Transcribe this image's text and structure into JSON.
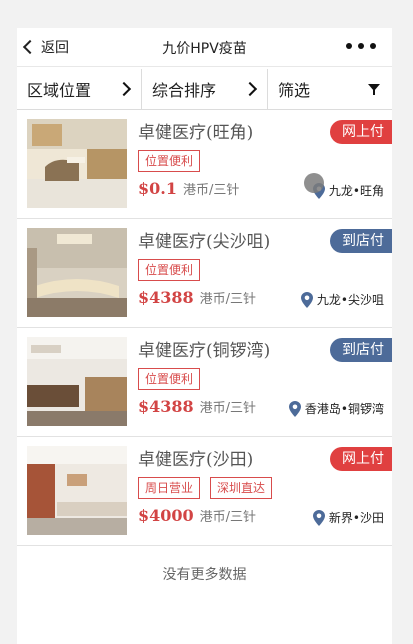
{
  "nav": {
    "back_label": "返回",
    "title": "九价HPV疫苗"
  },
  "filters": [
    {
      "label": "区域位置",
      "icon": "chevron-right-icon"
    },
    {
      "label": "综合排序",
      "icon": "chevron-right-icon"
    },
    {
      "label": "筛选",
      "icon": "filter-icon"
    }
  ],
  "clinics": [
    {
      "name": "卓健医疗(旺角)",
      "payment": "网上付",
      "payment_color": "#e04040",
      "tags": [
        "位置便利"
      ],
      "price": "$0.1",
      "unit": "港币/三针",
      "location": "九龙•旺角"
    },
    {
      "name": "卓健医疗(尖沙咀)",
      "payment": "到店付",
      "payment_color": "#4d6b99",
      "tags": [
        "位置便利"
      ],
      "price": "$4388",
      "unit": "港币/三针",
      "location": "九龙•尖沙咀"
    },
    {
      "name": "卓健医疗(铜锣湾)",
      "payment": "到店付",
      "payment_color": "#4d6b99",
      "tags": [
        "位置便利"
      ],
      "price": "$4388",
      "unit": "港币/三针",
      "location": "香港岛•铜锣湾"
    },
    {
      "name": "卓健医疗(沙田)",
      "payment": "网上付",
      "payment_color": "#e04040",
      "tags": [
        "周日营业",
        "深圳直达"
      ],
      "price": "$4000",
      "unit": "港币/三针",
      "location": "新界•沙田"
    }
  ],
  "footer_text": "没有更多数据",
  "colors": {
    "price": "#d24444",
    "tag_border": "#d84c4c",
    "pin": "#4d6b99"
  }
}
